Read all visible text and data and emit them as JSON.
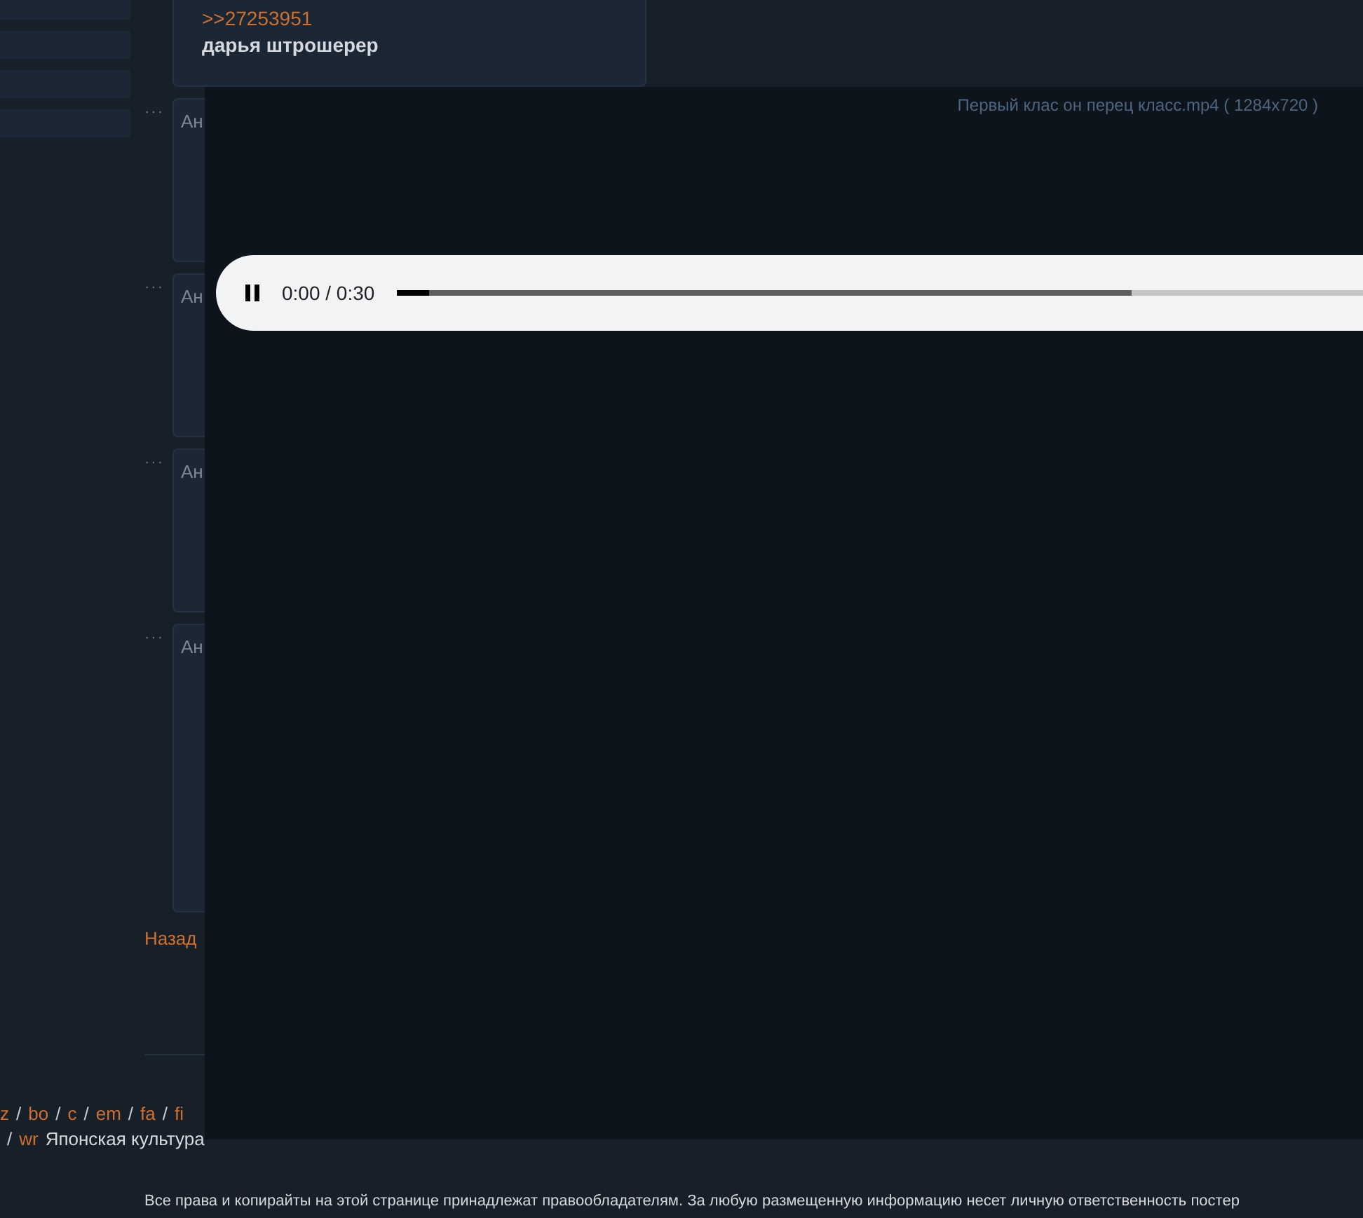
{
  "sidebar": {
    "items": [
      {
        "kind": "bar"
      },
      {
        "kind": "bar"
      },
      {
        "kind": "bar"
      },
      {
        "kind": "bar"
      }
    ]
  },
  "top_post": {
    "reply_link": ">>27253951",
    "text": "дарья штрошерер"
  },
  "posts": [
    {
      "menu": "···",
      "author": "Ан",
      "kind": "text"
    },
    {
      "menu": "···",
      "author": "Ан",
      "kind": "text"
    },
    {
      "menu": "···",
      "author": "Ан",
      "kind": "text"
    },
    {
      "menu": "···",
      "author": "Ан",
      "kind": "image"
    }
  ],
  "back_link": "Назад",
  "board_links": {
    "line_1": [
      {
        "text": "z",
        "kind": "link"
      },
      {
        "text": "/",
        "kind": "sep"
      },
      {
        "text": "bo",
        "kind": "link"
      },
      {
        "text": "/",
        "kind": "sep"
      },
      {
        "text": "c",
        "kind": "link"
      },
      {
        "text": "/",
        "kind": "sep"
      },
      {
        "text": "em",
        "kind": "link"
      },
      {
        "text": "/",
        "kind": "sep"
      },
      {
        "text": "fa",
        "kind": "link"
      },
      {
        "text": "/",
        "kind": "sep"
      },
      {
        "text": "fi",
        "kind": "link"
      }
    ],
    "line_2": [
      {
        "text": "/",
        "kind": "sep"
      },
      {
        "text": "wr",
        "kind": "link"
      },
      {
        "text": "Японская культура",
        "kind": "label"
      }
    ]
  },
  "footer": {
    "line_1": "Все права и копирайты на этой странице принадлежат правообладателям. За любую размещенную информацию несет личную ответственность постер"
  },
  "viewer": {
    "caption": "Первый клас он перец класс.mp4 ( 1284x720 )",
    "player": {
      "playing": true,
      "time": "0:00 / 0:30",
      "progress": {
        "level": 0.033
      },
      "buffer": {
        "level": 0.76
      }
    }
  }
}
